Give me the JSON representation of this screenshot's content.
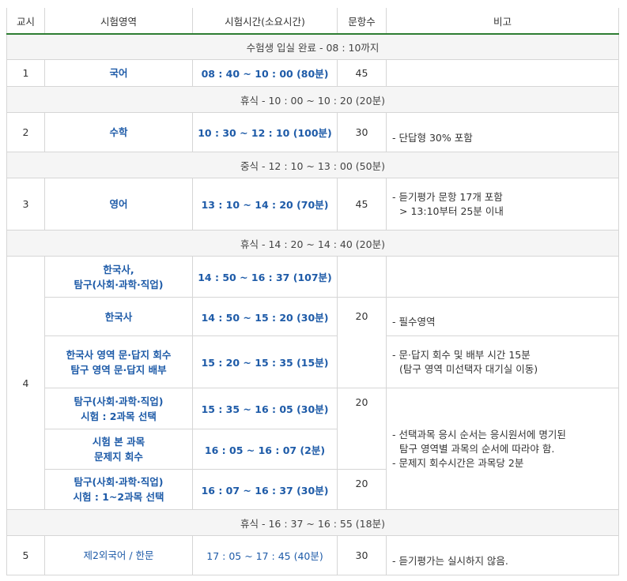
{
  "headers": [
    "교시",
    "시험영역",
    "시험시간(소요시간)",
    "문항수",
    "비고"
  ],
  "bands": {
    "entry": "수험생 입실 완료 - 08 : 10까지",
    "break1": "휴식 - 10 : 00 ~ 10 : 20 (20분)",
    "lunch": "중식 - 12 : 10 ~ 13 : 00 (50분)",
    "break2": "휴식 - 14 : 20 ~ 14 : 40 (20분)",
    "break3": "휴식 - 16 : 37 ~ 16 : 55 (18분)"
  },
  "p1": {
    "period": "1",
    "subject": "국어",
    "time": "08 : 40 ~ 10 : 00 (80분)",
    "count": "45"
  },
  "p2": {
    "period": "2",
    "subject": "수학",
    "time": "10 : 30 ~ 12 : 10 (100분)",
    "count": "30",
    "note": "- 단답형 30% 포함"
  },
  "p3": {
    "period": "3",
    "subject": "영어",
    "time": "13 : 10 ~ 14 : 20 (70분)",
    "count": "45",
    "note1": "- 듣기평가 문항 17개 포함",
    "note2": "> 13:10부터 25분 이내"
  },
  "p4": {
    "period": "4",
    "r1": {
      "subject1": "한국사,",
      "subject2": "탐구(사회·과학·직업)",
      "time": "14 : 50 ~ 16 : 37 (107분)"
    },
    "r2": {
      "subject": "한국사",
      "time": "14 : 50 ~ 15 : 20 (30분)",
      "count": "20",
      "note": "- 필수영역"
    },
    "r3": {
      "subject1": "한국사 영역 문·답지 회수",
      "subject2": "탐구 영역 문·답지 배부",
      "time": "15 : 20 ~ 15 : 35 (15분)",
      "note1": "- 문·답지 회수 및 배부 시간 15분",
      "note2": "(탐구 영역 미선택자 대기실 이동)"
    },
    "r4": {
      "subject1": "탐구(사회·과학·직업)",
      "subject2": "시험 : 2과목 선택",
      "time": "15 : 35 ~ 16 : 05 (30분)",
      "count": "20"
    },
    "r5": {
      "subject1": "시험 본 과목",
      "subject2": "문제지 회수",
      "time": "16 : 05 ~ 16 : 07 (2분)"
    },
    "r6": {
      "subject1": "탐구(사회·과학·직업)",
      "subject2": "시험 : 1~2과목 선택",
      "time": "16 : 07 ~ 16 : 37 (30분)",
      "count": "20"
    },
    "note_a": "- 선택과목 응시 순서는 응시원서에 명기된",
    "note_b": "탐구 영역별 과목의 순서에 따라야 함.",
    "note_c": "- 문제지 회수시간은 과목당 2분"
  },
  "p5": {
    "period": "5",
    "subject": "제2외국어 / 한문",
    "time": "17 : 05 ~ 17 : 45 (40분)",
    "count": "30",
    "note": "- 듣기평가는 실시하지 않음."
  }
}
